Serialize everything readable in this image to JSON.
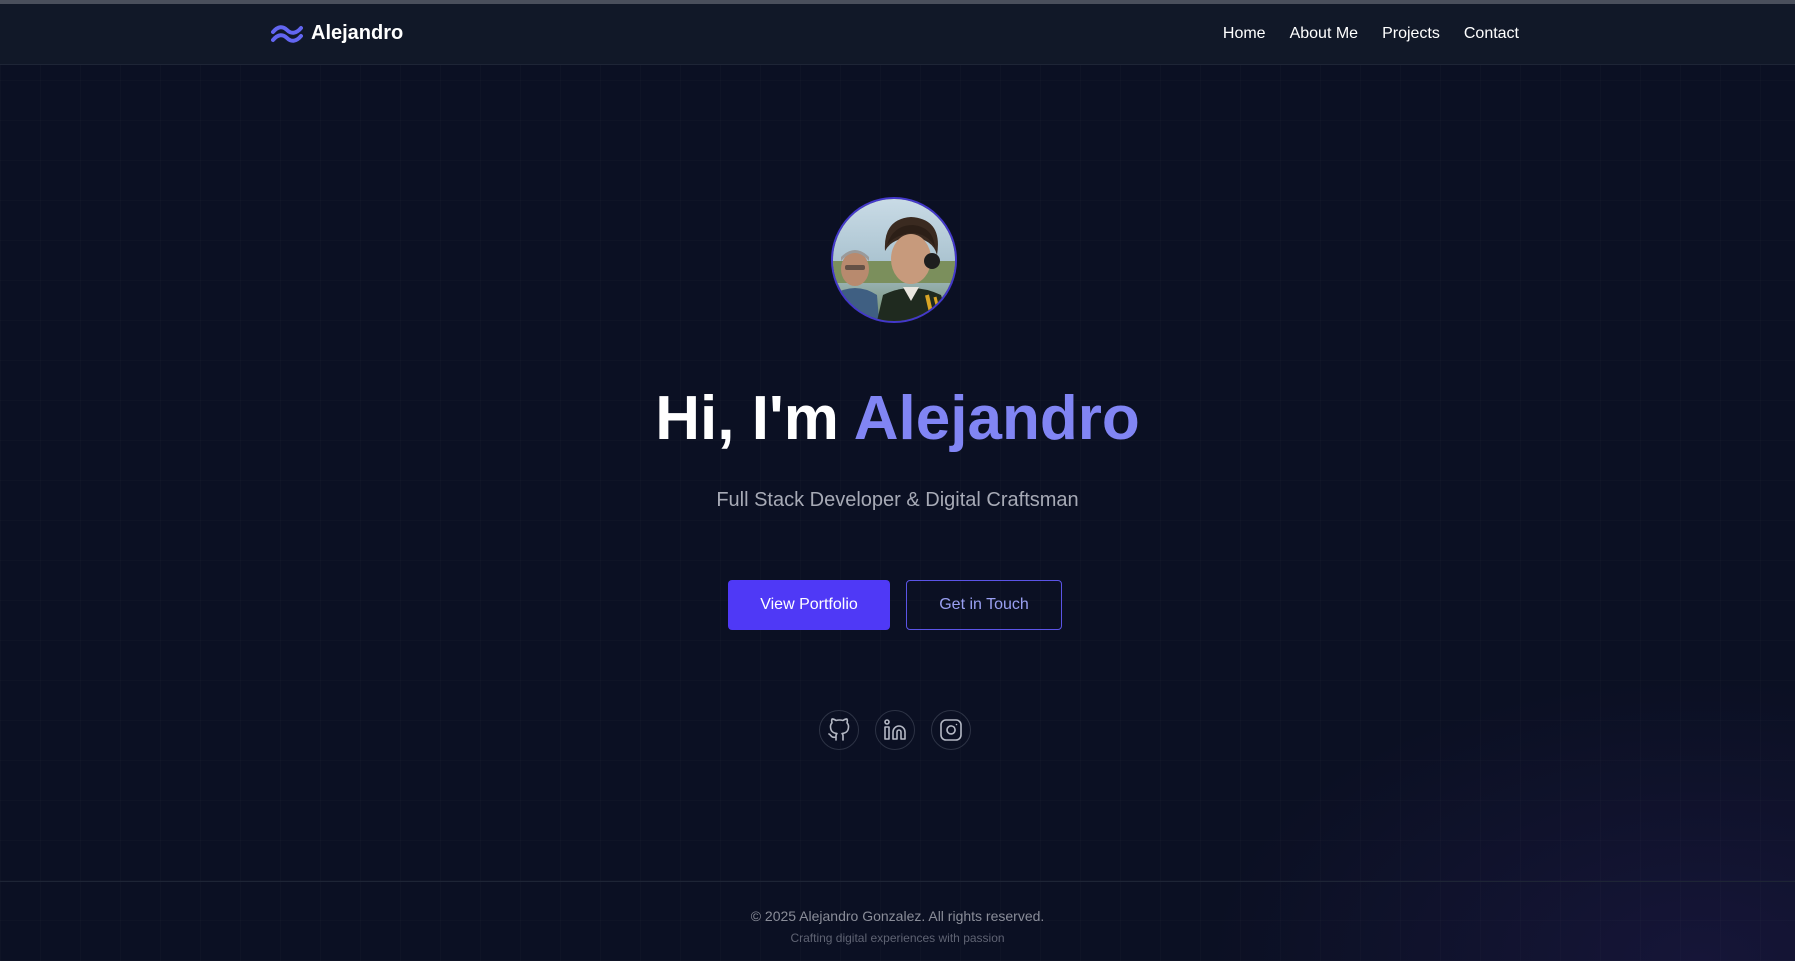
{
  "brand": {
    "name": "Alejandro",
    "logo_icon": "wave-logo-icon",
    "logo_color": "#6366f1"
  },
  "nav": {
    "items": [
      {
        "label": "Home"
      },
      {
        "label": "About Me"
      },
      {
        "label": "Projects"
      },
      {
        "label": "Contact"
      }
    ]
  },
  "hero": {
    "avatar_icon": "profile-photo",
    "greeting": "Hi, I'm ",
    "name": "Alejandro",
    "subtitle": "Full Stack Developer & Digital Craftsman",
    "primary_button": "View Portfolio",
    "secondary_button": "Get in Touch",
    "accent_color": "#8185f4",
    "button_color": "#4f39f6"
  },
  "social": [
    {
      "icon": "github-icon"
    },
    {
      "icon": "linkedin-icon"
    },
    {
      "icon": "instagram-icon"
    }
  ],
  "footer": {
    "copyright": "© 2025 Alejandro Gonzalez. All rights reserved.",
    "tagline": "Crafting digital experiences with passion"
  }
}
